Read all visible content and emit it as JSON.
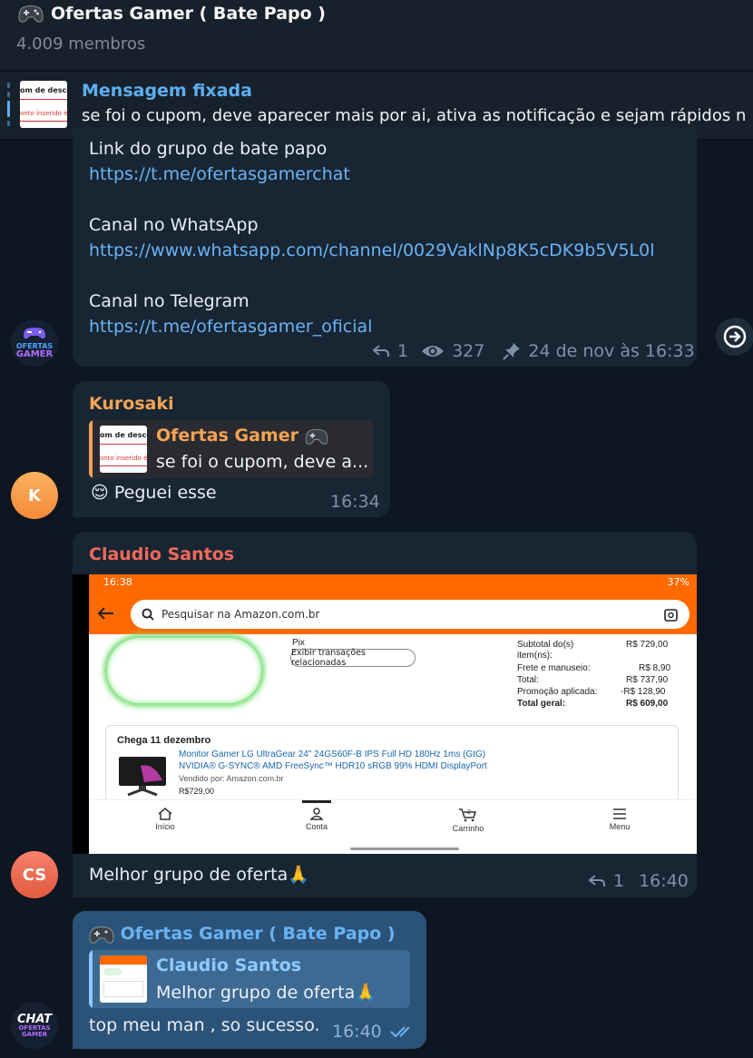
{
  "header": {
    "title": "Ofertas Gamer ( Bate Papo )",
    "members": "4.009 membros"
  },
  "pinned": {
    "label": "Mensagem fixada",
    "text": "se foi o cupom, deve aparecer mais por ai, ativa as notificação e sejam rápidos n",
    "thumb_line1": "om de descont",
    "thumb_line2": "onto inserido é im"
  },
  "message1": {
    "lines": [
      {
        "text": "Link do grupo de bate papo",
        "type": "text"
      },
      {
        "text": "https://t.me/ofertasgamerchat",
        "type": "link"
      },
      {
        "text": "Canal no WhatsApp",
        "type": "text"
      },
      {
        "text": "https://www.whatsapp.com/channel/0029VaklNp8K5cDK9b5V5L0l",
        "type": "link"
      },
      {
        "text": "Canal no Telegram",
        "type": "text"
      },
      {
        "text": "https://t.me/ofertasgamer_oficial",
        "type": "link"
      }
    ],
    "replies": "1",
    "views": "327",
    "date": "24 de nov às 16:33",
    "avatar_text": "OFERTAS GAMER"
  },
  "message2": {
    "sender": "Kurosaki",
    "sender_color": "#f5a454",
    "reply_title": "Ofertas Gamer",
    "reply_text": "se foi o cupom, deve a...",
    "text": "Peguei esse",
    "emoji": "😌",
    "time": "16:34",
    "avatar": "K"
  },
  "message3": {
    "sender": "Claudio Santos",
    "sender_color": "#f16a5a",
    "text": "Melhor grupo de oferta",
    "emoji": "🙏",
    "replies": "1",
    "time": "16:40",
    "avatar": "CS",
    "screenshot": {
      "status_time": "16:38",
      "status_right": "37%",
      "search_placeholder": "Pesquisar na Amazon.com.br",
      "pix": "Pix",
      "button": "Exibir transações relacionadas",
      "summary": [
        {
          "label": "Subtotal do(s) item(ns):",
          "value": "R$ 729,00"
        },
        {
          "label": "Frete e manuseio:",
          "value": "R$ 8,90"
        },
        {
          "label": "Total:",
          "value": "R$ 737,90"
        },
        {
          "label": "Promoção aplicada:",
          "value": "-R$ 128,90"
        },
        {
          "label": "Total geral:",
          "value": "R$ 609,00"
        }
      ],
      "delivery": "Chega 11 dezembro",
      "product_line1": "Monitor Gamer LG UltraGear 24\" 24GS60F-B IPS Full HD 180Hz 1ms (GtG)",
      "product_line2": "NVIDIA® G-SYNC® AMD FreeSync™ HDR10 sRGB 99% HDMI DisplayPort",
      "seller": "Vendido por: Amazon.com.br",
      "price": "R$729,00",
      "nav": [
        "Início",
        "Conta",
        "Carrinho",
        "Menu"
      ],
      "cart_count": "2"
    }
  },
  "message4": {
    "sender": "Ofertas Gamer ( Bate Papo )",
    "sender_color": "#6ab3f3",
    "reply_title": "Claudio Santos",
    "reply_text": "Melhor grupo de oferta",
    "reply_emoji": "🙏",
    "text": "top meu man , so sucesso.",
    "time": "16:40",
    "avatar_top": "CHAT",
    "avatar_bottom": "OFERTAS GAMER"
  },
  "colors": {
    "background": "#0e1621",
    "header": "#17212b",
    "incoming": "#182533",
    "outgoing": "#2b5278",
    "link": "#6ab3f3",
    "meta": "#7f91a4"
  }
}
